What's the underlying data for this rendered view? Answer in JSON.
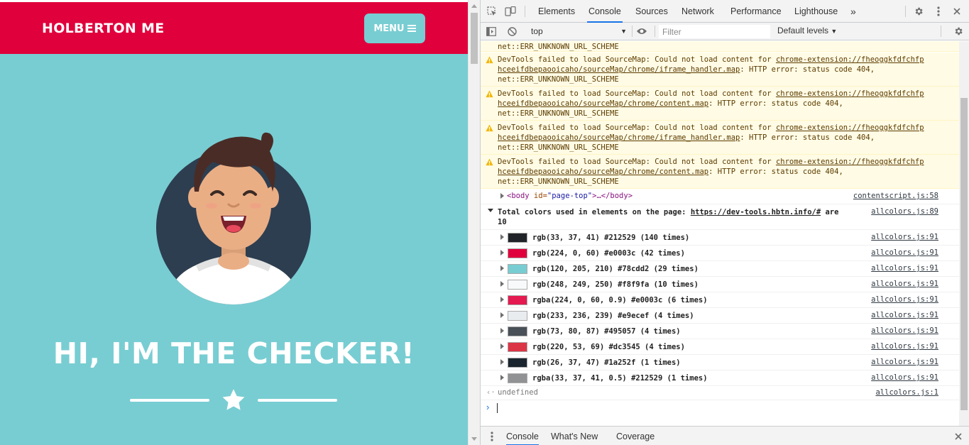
{
  "site": {
    "brand": "HOLBERTON ME",
    "menu_label": "MENU",
    "headline": "HI, I'M THE CHECKER!"
  },
  "devtools": {
    "tabs": [
      "Elements",
      "Console",
      "Sources",
      "Network",
      "Performance",
      "Lighthouse"
    ],
    "more_tabs": "»",
    "context": "top",
    "filter_placeholder": "Filter",
    "levels": "Default levels",
    "partial_top": "net::ERR_UNKNOWN_URL_SCHEME",
    "warnings": [
      {
        "prefix": "DevTools failed to load SourceMap: Could not load content for ",
        "url1": "chrome-extension://fheoggkfdfchfp",
        "url2": "hceeifdbepaooicaho/sourceMap/chrome/iframe_handler.map",
        "suffix": ": HTTP error: status code 404,",
        "err": "net::ERR_UNKNOWN_URL_SCHEME"
      },
      {
        "prefix": "DevTools failed to load SourceMap: Could not load content for ",
        "url1": "chrome-extension://fheoggkfdfchfp",
        "url2": "hceeifdbepaooicaho/sourceMap/chrome/content.map",
        "suffix": ": HTTP error: status code 404,",
        "err": "net::ERR_UNKNOWN_URL_SCHEME"
      },
      {
        "prefix": "DevTools failed to load SourceMap: Could not load content for ",
        "url1": "chrome-extension://fheoggkfdfchfp",
        "url2": "hceeifdbepaooicaho/sourceMap/chrome/iframe_handler.map",
        "suffix": ": HTTP error: status code 404,",
        "err": "net::ERR_UNKNOWN_URL_SCHEME"
      },
      {
        "prefix": "DevTools failed to load SourceMap: Could not load content for ",
        "url1": "chrome-extension://fheoggkfdfchfp",
        "url2": "hceeifdbepaooicaho/sourceMap/chrome/content.map",
        "suffix": ": HTTP error: status code 404,",
        "err": "net::ERR_UNKNOWN_URL_SCHEME"
      }
    ],
    "body_row": {
      "open": "<body",
      "attr": " id=",
      "val": "\"page-top\"",
      "close": ">…</body>",
      "source": "contentscript.js:58"
    },
    "summary": {
      "text": "Total colors used in elements on the page: ",
      "url": "https://dev-tools.hbtn.info/#",
      "tail": " are",
      "count": "10",
      "source": "allcolors.js:89"
    },
    "colors": [
      {
        "label": "rgb(33, 37, 41) #212529 (140 times)",
        "swatch": "#212529",
        "source": "allcolors.js:91"
      },
      {
        "label": "rgb(224, 0, 60) #e0003c (42 times)",
        "swatch": "#e0003c",
        "source": "allcolors.js:91"
      },
      {
        "label": "rgb(120, 205, 210) #78cdd2 (29 times)",
        "swatch": "#78cdd2",
        "source": "allcolors.js:91"
      },
      {
        "label": "rgb(248, 249, 250) #f8f9fa (10 times)",
        "swatch": "#f8f9fa",
        "source": "allcolors.js:91"
      },
      {
        "label": "rgba(224, 0, 60, 0.9) #e0003c (6 times)",
        "swatch": "#e41a50",
        "source": "allcolors.js:91"
      },
      {
        "label": "rgb(233, 236, 239) #e9ecef (4 times)",
        "swatch": "#e9ecef",
        "source": "allcolors.js:91"
      },
      {
        "label": "rgb(73, 80, 87) #495057 (4 times)",
        "swatch": "#495057",
        "source": "allcolors.js:91"
      },
      {
        "label": "rgb(220, 53, 69) #dc3545 (4 times)",
        "swatch": "#dc3545",
        "source": "allcolors.js:91"
      },
      {
        "label": "rgb(26, 37, 47) #1a252f (1 times)",
        "swatch": "#1a252f",
        "source": "allcolors.js:91"
      },
      {
        "label": "rgba(33, 37, 41, 0.5) #212529 (1 times)",
        "swatch": "#909294",
        "source": "allcolors.js:91"
      }
    ],
    "result": {
      "text": "undefined",
      "source": "allcolors.js:1"
    },
    "drawer_tabs": [
      "Console",
      "What's New",
      "Coverage"
    ]
  }
}
